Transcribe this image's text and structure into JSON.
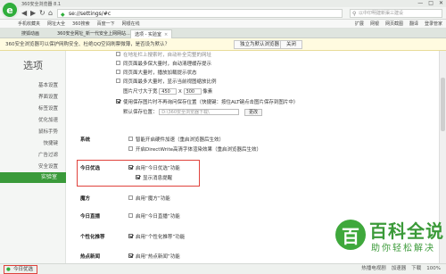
{
  "window": {
    "title": "360安全浏览器 8.1",
    "controls": [
      "—",
      "□",
      "✕"
    ]
  },
  "nav": {
    "url": "se://settings/#c",
    "search_placeholder": "以中印明建新渠三建设"
  },
  "bookmarks": [
    "手机收藏夹",
    "网址大全",
    "360搜索",
    "百度一下",
    "网银在线"
  ],
  "bookmarks_right": [
    "扩展",
    "网银",
    "网页截图",
    "翻译",
    "登录管家"
  ],
  "tabs": [
    {
      "label": "搜狐动画"
    },
    {
      "label": "360安全网址_新一代安全上网网站..."
    },
    {
      "label": "选项 - 实验室",
      "active": true
    }
  ],
  "notify": {
    "text": "360安全浏览器可以保护网购安全、杜绝QQ空间刷票微薄，是否设为默认？",
    "set_default": "独立为默认浏览器",
    "close": "关闭"
  },
  "sidebar": {
    "title": "选项",
    "items": [
      "基本设置",
      "界面设置",
      "标签设置",
      "优化加速",
      "鼠标手势",
      "快捷键",
      "广告过滤",
      "安全设置",
      "实验室"
    ]
  },
  "content": {
    "top_lines": [
      "在地址栏上搜索时，自动补全完整的网址",
      "同页面最多保大量时，自动清理缓存提示",
      "同页面大量时，播放加载提示状态",
      "同页面最多大量时，显示当前视图缩放比例"
    ],
    "size_label": "图片尺寸大于宽",
    "width_val": "450",
    "x_label": "X",
    "height_val": "300",
    "px_label": "像素",
    "save_line": "使用保存图片时不再询问保存位置（快捷键：按住ALT键点击图片保存到图片中）",
    "default_save_label": "默认保存位置：",
    "default_save_path": "D:\\360安全浏览器下载\\",
    "change_btn": "更改",
    "system_label": "系统",
    "system_lines": [
      "智能开启硬件加速（重启浏览器后生效）",
      "开启DirectWrite高清字体渲染效果（重启浏览器后生效）"
    ],
    "today_label": "今日优选",
    "today_lines": [
      "启用“今日优选”功能",
      "显示消息提醒"
    ],
    "magic_label": "魔方",
    "magic_line": "启用“魔方”功能",
    "live_label": "今日直播",
    "live_line": "启用“今日直播”功能",
    "personal_label": "个性化推荐",
    "personal_line": "启用“个性化推荐”功能",
    "hot_label": "热点新闻",
    "hot_line": "启用“热点新闻”功能"
  },
  "status": {
    "left": "今日优选",
    "right": [
      "热播电视剧",
      "加速器",
      "下载",
      "100%"
    ]
  },
  "watermark": {
    "big": "百科全说",
    "small": "助你轻松解决"
  }
}
